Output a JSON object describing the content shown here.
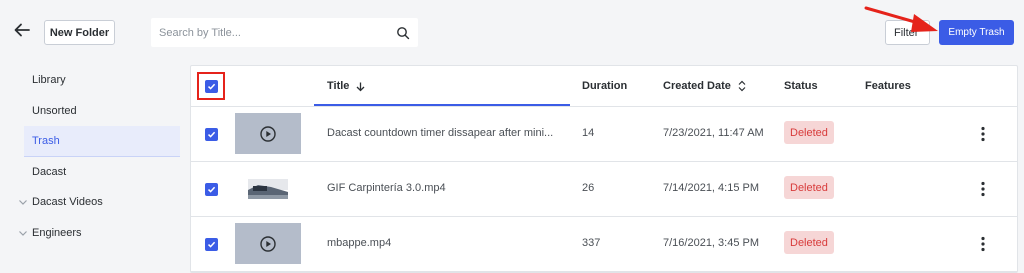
{
  "toolbar": {
    "new_folder_label": "New Folder",
    "search_placeholder": "Search by Title...",
    "filter_label": "Filter",
    "empty_trash_label": "Empty Trash"
  },
  "sidebar": {
    "items": [
      {
        "label": "Library"
      },
      {
        "label": "Unsorted"
      },
      {
        "label": "Trash",
        "active": true
      },
      {
        "label": "Dacast"
      },
      {
        "label": "Dacast Videos",
        "expandable": true
      },
      {
        "label": "Engineers",
        "expandable": true
      }
    ]
  },
  "table": {
    "columns": {
      "title": "Title",
      "duration": "Duration",
      "created_date": "Created Date",
      "status": "Status",
      "features": "Features"
    },
    "rows": [
      {
        "title": "Dacast countdown timer dissapear after mini...",
        "duration": "14",
        "created": "7/23/2021, 11:47 AM",
        "status": "Deleted",
        "thumb": "play-placeholder"
      },
      {
        "title": "GIF Carpintería 3.0.mp4",
        "duration": "26",
        "created": "7/14/2021, 4:15 PM",
        "status": "Deleted",
        "thumb": "image"
      },
      {
        "title": "mbappe.mp4",
        "duration": "337",
        "created": "7/16/2021, 3:45 PM",
        "status": "Deleted",
        "thumb": "play-placeholder"
      }
    ]
  },
  "colors": {
    "accent": "#3b5ce6",
    "annotation_red": "#e5231b",
    "deleted_badge_bg": "#f6d6d6",
    "deleted_badge_text": "#d83b3b"
  },
  "icons": [
    "back-arrow-icon",
    "search-icon",
    "sort-down-icon",
    "sort-toggle-icon",
    "play-icon",
    "more-vertical-icon",
    "chevron-down-icon",
    "checkmark-icon"
  ]
}
